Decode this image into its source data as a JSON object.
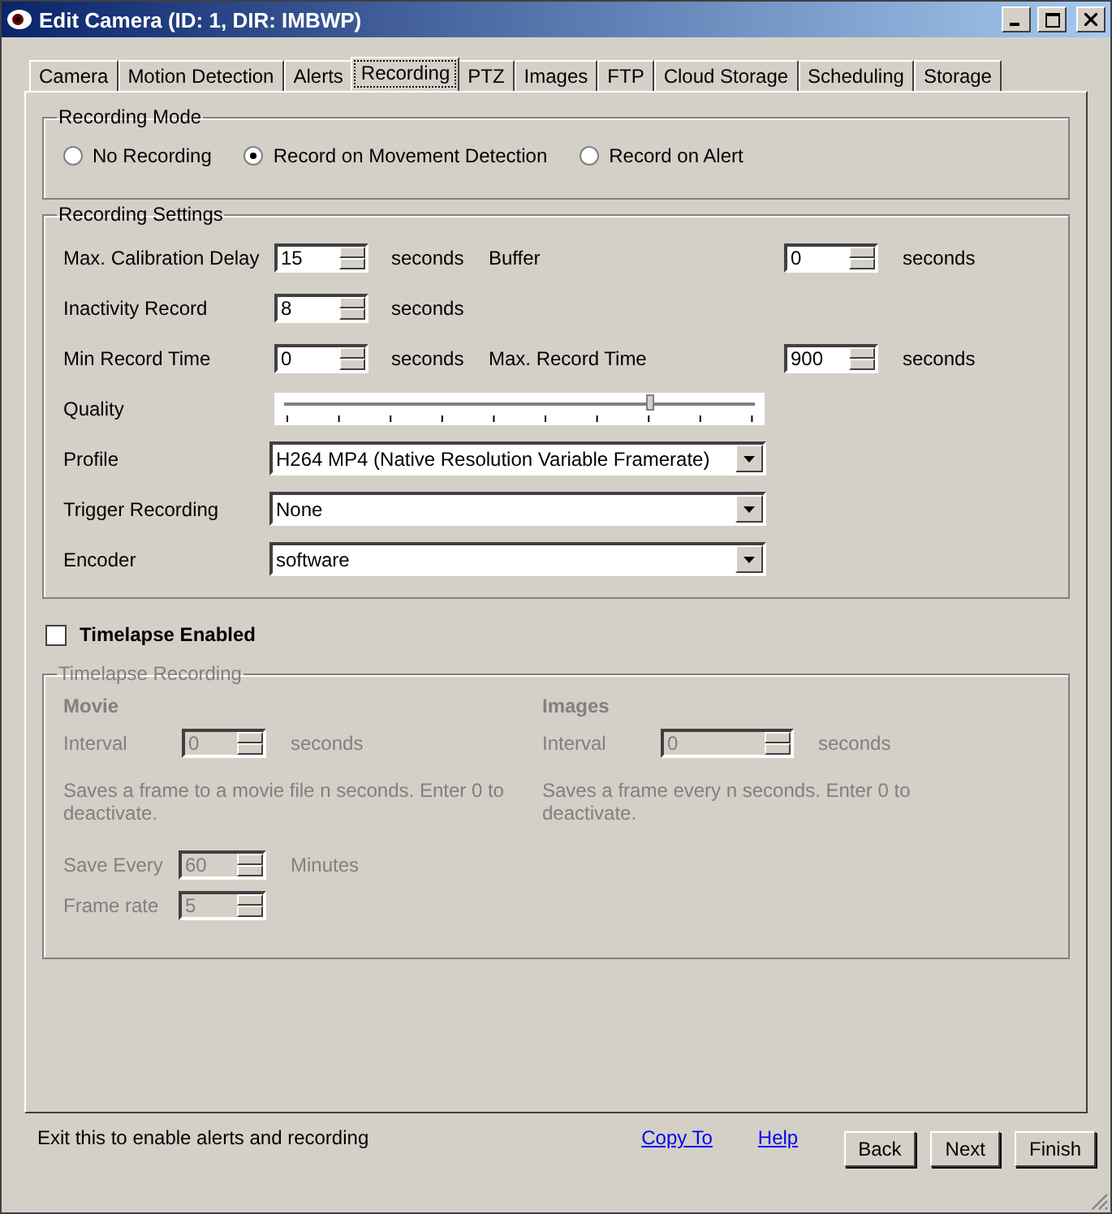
{
  "window": {
    "title": "Edit Camera (ID: 1, DIR: IMBWP)"
  },
  "tabs": [
    {
      "label": "Camera",
      "selected": false
    },
    {
      "label": "Motion Detection",
      "selected": false
    },
    {
      "label": "Alerts",
      "selected": false
    },
    {
      "label": "Recording",
      "selected": true
    },
    {
      "label": "PTZ",
      "selected": false
    },
    {
      "label": "Images",
      "selected": false
    },
    {
      "label": "FTP",
      "selected": false
    },
    {
      "label": "Cloud Storage",
      "selected": false
    },
    {
      "label": "Scheduling",
      "selected": false
    },
    {
      "label": "Storage",
      "selected": false
    }
  ],
  "recording_mode": {
    "title": "Recording Mode",
    "options": [
      {
        "label": "No Recording",
        "selected": false
      },
      {
        "label": "Record on Movement Detection",
        "selected": true
      },
      {
        "label": "Record on Alert",
        "selected": false
      }
    ]
  },
  "recording_settings": {
    "title": "Recording Settings",
    "rows": [
      {
        "kind": "spin",
        "label": "Max. Calibration Delay",
        "value": "15",
        "unit": "seconds",
        "second": {
          "label": "Buffer",
          "value": "0",
          "unit": "seconds"
        }
      },
      {
        "kind": "spin",
        "label": "Inactivity Record",
        "value": "8",
        "unit": "seconds"
      },
      {
        "kind": "spin",
        "label": "Min Record Time",
        "value": "0",
        "unit": "seconds",
        "second": {
          "label": "Max. Record Time",
          "value": "900",
          "unit": "seconds"
        }
      },
      {
        "kind": "slider",
        "label": "Quality",
        "level": 0.78
      },
      {
        "kind": "select",
        "label": "Profile",
        "value": "H264 MP4 (Native Resolution Variable Framerate)"
      },
      {
        "kind": "select",
        "label": "Trigger Recording",
        "value": "None"
      },
      {
        "kind": "select",
        "label": "Encoder",
        "value": "software"
      }
    ]
  },
  "timelapse": {
    "label": "Timelapse Enabled",
    "checked": false
  },
  "timelapse_recording": {
    "title": "Timelapse Recording",
    "columns": [
      {
        "heading": "Movie",
        "interval_label": "Interval",
        "interval_value": "0",
        "interval_unit": "seconds",
        "note": "Saves a frame to a movie file n seconds. Enter 0 to deactivate.",
        "extras": [
          {
            "label": "Save Every",
            "value": "60",
            "unit": "Minutes"
          },
          {
            "label": "Frame rate",
            "value": "5"
          }
        ]
      },
      {
        "heading": "Images",
        "interval_label": "Interval",
        "interval_value": "0",
        "interval_unit": "seconds",
        "note": "Saves a frame every n seconds. Enter 0 to deactivate."
      }
    ]
  },
  "footer": {
    "message": "Exit this to enable alerts and recording",
    "links": [
      "Copy To",
      "Help"
    ],
    "buttons": [
      "Back",
      "Next",
      "Finish"
    ]
  }
}
